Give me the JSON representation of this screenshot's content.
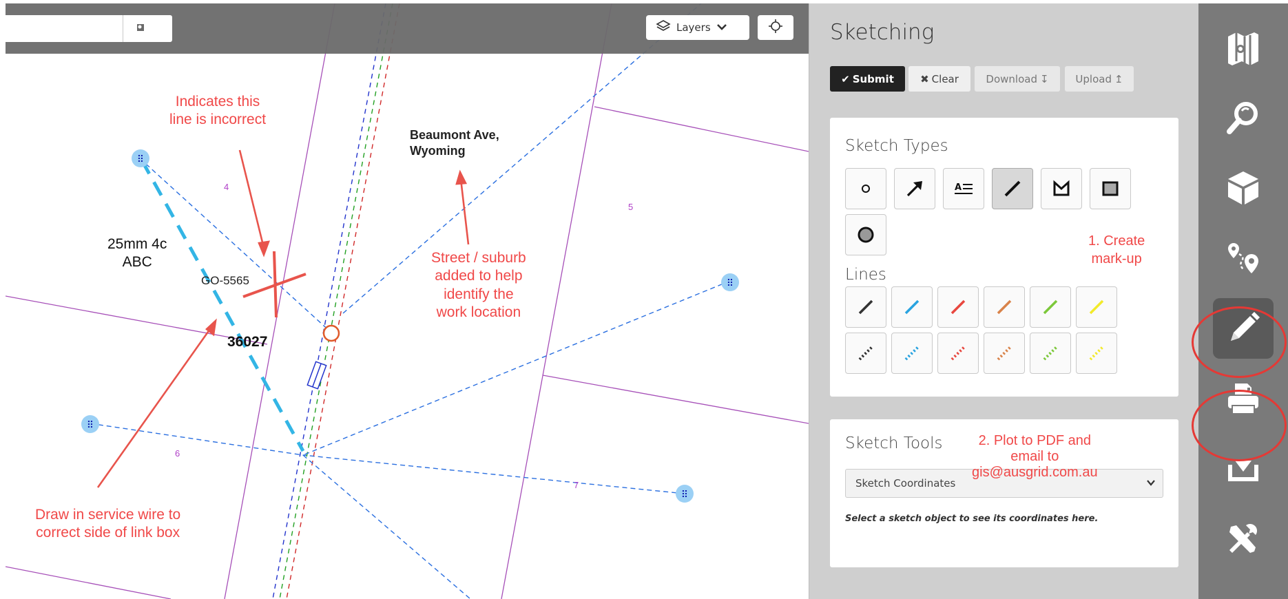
{
  "toolbar": {
    "layers_label": "Layers",
    "basemap_icon": "basemap-icon",
    "locate_icon": "crosshair-icon",
    "layers_icon": "layers-stack-icon"
  },
  "map": {
    "street_label": [
      "Beaumont Ave,",
      "Wyoming"
    ],
    "cable_label": [
      "25mm 4c",
      "ABC"
    ],
    "pole_label": "GO-5565",
    "asset_label": "36027",
    "lot_numbers": [
      "4",
      "5",
      "6",
      "7"
    ],
    "annotations": {
      "incorrect": [
        "Indicates this",
        "line is incorrect"
      ],
      "street": [
        "Street / suburb",
        "added to help",
        "identify the",
        "work location"
      ],
      "service_wire": [
        "Draw in service wire to",
        "correct side of link box"
      ],
      "create_markup": [
        "1. Create",
        "mark-up"
      ],
      "plot_pdf": [
        "2. Plot to PDF and",
        "email to",
        "gis@ausgrid.com.au"
      ]
    }
  },
  "panel": {
    "title": "Sketching",
    "buttons": {
      "submit": "Submit",
      "clear": "Clear",
      "download": "Download",
      "upload": "Upload"
    },
    "sketch_types_heading": "Sketch Types",
    "sketch_types": [
      "point",
      "arrow",
      "text",
      "line",
      "polygon",
      "rectangle",
      "circle"
    ],
    "active_sketch_type": "line",
    "lines_heading": "Lines",
    "line_colors": [
      "#333333",
      "#29a3e0",
      "#e8473f",
      "#d9834a",
      "#7cc83a",
      "#f2ea2a"
    ],
    "sketch_tools_heading": "Sketch Tools",
    "coordinates_select": "Sketch Coordinates",
    "coordinates_hint": "Select a sketch object to see its coordinates here."
  },
  "rail": {
    "items": [
      "map-layers-icon",
      "search-icon",
      "3d-cube-icon",
      "route-pin-icon",
      "pencil-icon",
      "print-icon",
      "tray-download-icon",
      "tools-icon"
    ],
    "active": "pencil-icon"
  },
  "colors": {
    "annotation": "#f04848",
    "panel_bg": "#cfcfcf",
    "rail_bg": "#7a7a7a",
    "highlight_circle": "#e53935"
  }
}
